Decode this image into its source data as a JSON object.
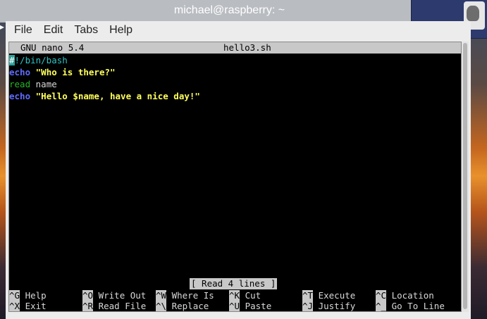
{
  "window": {
    "title": "michael@raspberry: ~"
  },
  "menu": [
    "File",
    "Edit",
    "Tabs",
    "Help"
  ],
  "nano": {
    "version": "GNU nano 5.4",
    "filename": "hello3.sh",
    "status": "[ Read 4 lines ]"
  },
  "code": {
    "line1": {
      "cursor": "#",
      "rest": "!/bin/bash"
    },
    "line2": {
      "kw": "echo",
      "str": "\"Who is there?\""
    },
    "line3": {
      "kw": "read",
      "arg": "name"
    },
    "line4": {
      "kw": "echo",
      "str": "\"Hello $name, have a nice day!\""
    }
  },
  "shortcuts": [
    {
      "key": "^G",
      "label": "Help"
    },
    {
      "key": "^O",
      "label": "Write Out"
    },
    {
      "key": "^W",
      "label": "Where Is"
    },
    {
      "key": "^K",
      "label": "Cut"
    },
    {
      "key": "^T",
      "label": "Execute"
    },
    {
      "key": "^C",
      "label": "Location"
    },
    {
      "key": "^X",
      "label": "Exit"
    },
    {
      "key": "^R",
      "label": "Read File"
    },
    {
      "key": "^\\",
      "label": "Replace"
    },
    {
      "key": "^U",
      "label": "Paste"
    },
    {
      "key": "^J",
      "label": "Justify"
    },
    {
      "key": "^_",
      "label": "Go To Line"
    }
  ],
  "colors": {
    "keyword": "#5f6bff",
    "string": "#ffff5c",
    "shebang": "#2ec4c4",
    "read": "#26b526",
    "terminal_bg": "#000000"
  }
}
